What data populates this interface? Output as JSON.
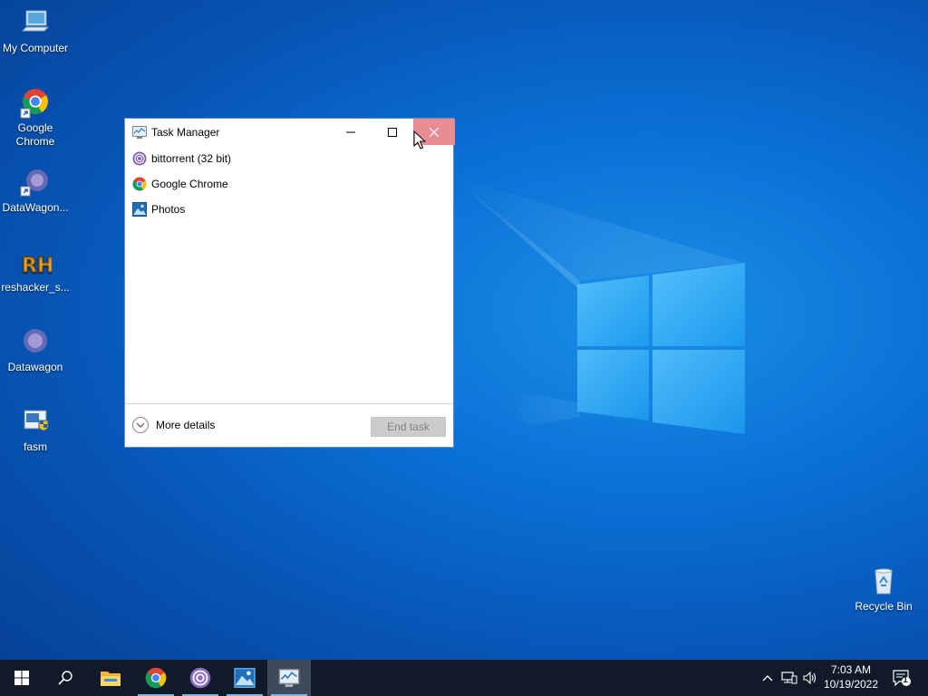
{
  "desktop": {
    "icons": [
      {
        "label": "My Computer"
      },
      {
        "label": "Google Chrome"
      },
      {
        "label": "DataWagon..."
      },
      {
        "label": "reshacker_s..."
      },
      {
        "label": "Datawagon"
      },
      {
        "label": "fasm"
      },
      {
        "label": "Recycle Bin"
      }
    ]
  },
  "task_manager": {
    "title": "Task Manager",
    "processes": [
      {
        "name": "bittorrent (32 bit)",
        "icon": "bittorrent-icon"
      },
      {
        "name": "Google Chrome",
        "icon": "chrome-icon"
      },
      {
        "name": "Photos",
        "icon": "photos-icon"
      }
    ],
    "more_details": "More details",
    "end_task": "End task"
  },
  "taskbar": {
    "time": "7:03 AM",
    "date": "10/19/2022",
    "notification_count": "1"
  },
  "colors": {
    "desktop_blue": "#0a6fd4",
    "taskbar_bg": "#101a28",
    "close_hover": "#e98c93",
    "accent": "#76b9ed"
  }
}
